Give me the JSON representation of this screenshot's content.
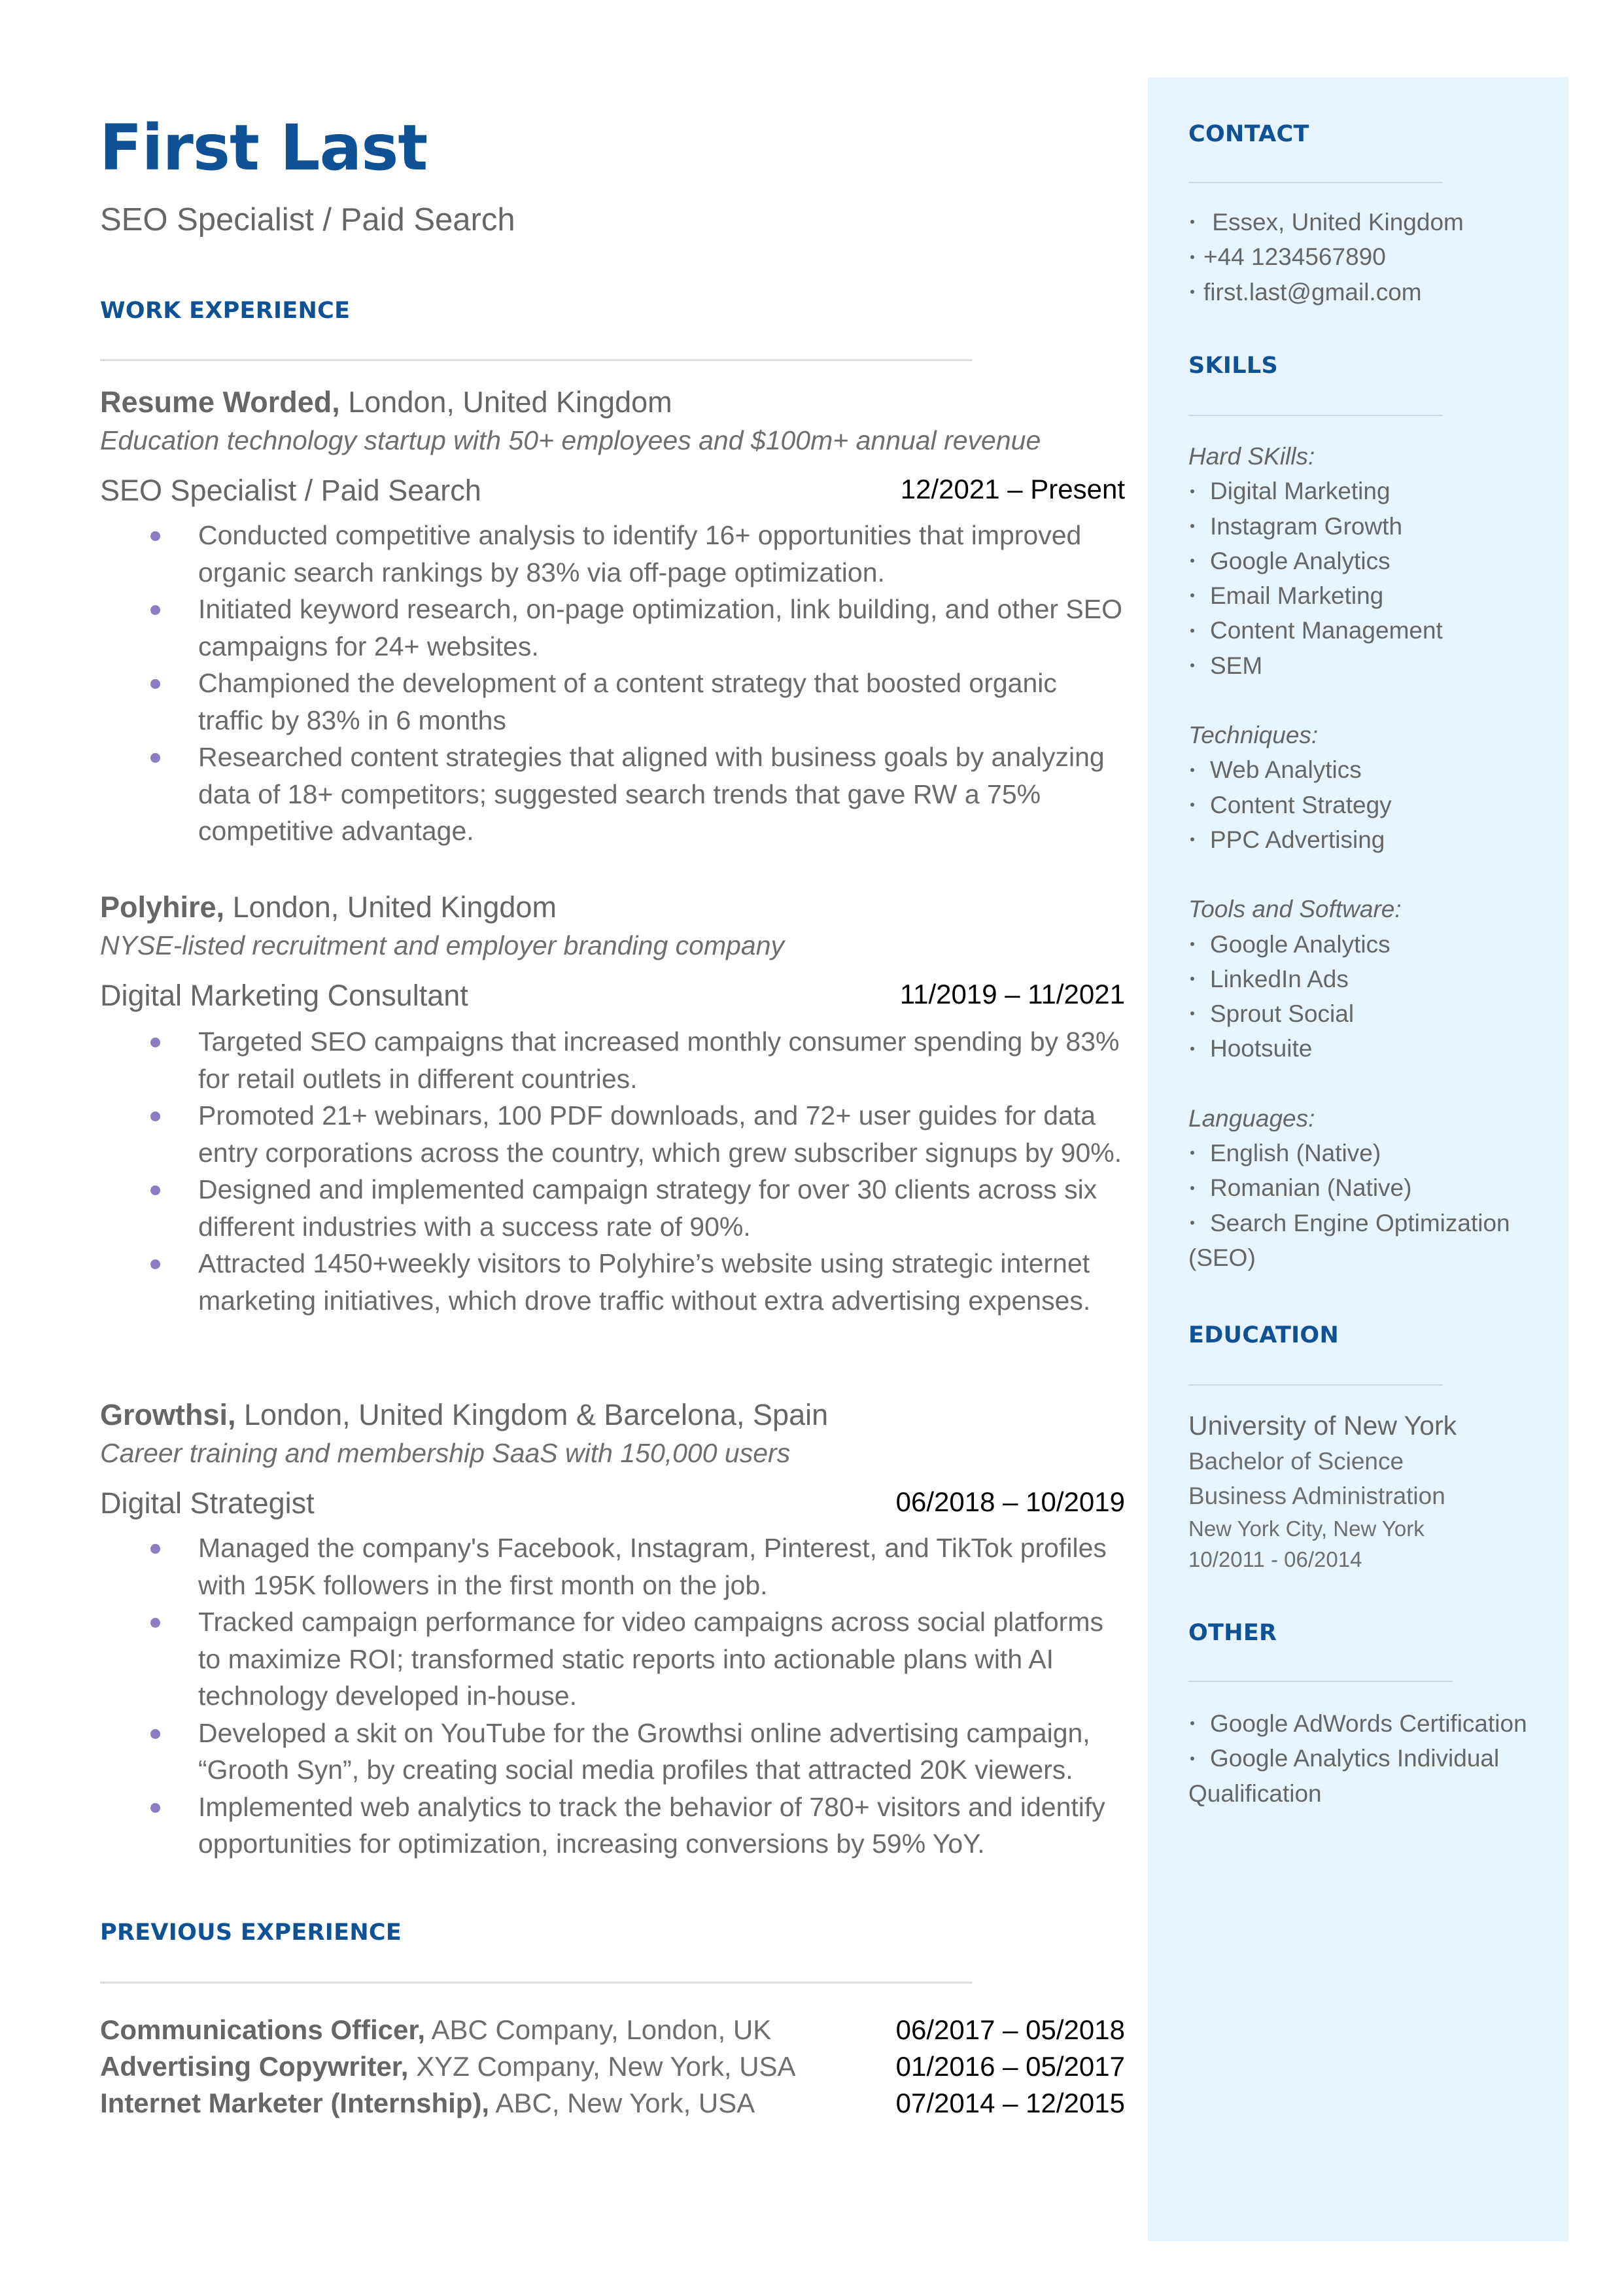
{
  "header": {
    "name": "First Last",
    "title": "SEO Specialist / Paid Search"
  },
  "sections": {
    "work_experience": "WORK EXPERIENCE",
    "previous_experience": "PREVIOUS EXPERIENCE",
    "contact": "CONTACT",
    "skills": "SKILLS",
    "education": "EDUCATION",
    "other": "OTHER"
  },
  "jobs": [
    {
      "company": "Resume Worded,",
      "location": " London, United Kingdom",
      "description": "Education technology startup with 50+ employees and $100m+ annual revenue",
      "role": "SEO Specialist / Paid Search",
      "dates": "12/2021 – Present",
      "bullets": [
        "Conducted competitive analysis to identify 16+ opportunities that improved organic search rankings by 83% via off-page optimization.",
        "Initiated keyword research, on-page optimization, link building, and other SEO campaigns for 24+ websites.",
        "Championed the development of a content strategy that boosted organic traffic by 83% in 6 months",
        "Researched content strategies that aligned with business goals by analyzing data of 18+ competitors; suggested search trends that gave RW a 75% competitive advantage."
      ]
    },
    {
      "company": "Polyhire,",
      "location": " London, United Kingdom",
      "description": "NYSE-listed recruitment and employer branding company",
      "role": "Digital Marketing Consultant",
      "dates": "11/2019 – 11/2021",
      "bullets": [
        "Targeted SEO campaigns that increased monthly consumer spending by 83% for retail outlets in different countries.",
        "Promoted 21+ webinars, 100 PDF downloads, and 72+ user guides for data entry corporations across the country, which grew subscriber signups by 90%.",
        "Designed and implemented campaign strategy for over 30 clients across six different industries with a success rate of 90%.",
        "Attracted 1450+weekly visitors to Polyhire’s website using strategic internet marketing initiatives, which drove traffic without extra advertising expenses."
      ]
    },
    {
      "company": "Growthsi,",
      "location": " London, United Kingdom & Barcelona, Spain",
      "description": "Career training and membership SaaS with 150,000 users",
      "role": "Digital Strategist",
      "dates": "06/2018 – 10/2019",
      "bullets": [
        "Managed the company's Facebook, Instagram, Pinterest, and TikTok profiles with 195K followers in the first month on the job.",
        "Tracked campaign performance for video campaigns across social platforms to maximize ROI; transformed static reports into actionable plans with AI technology developed in-house.",
        "Developed a skit on YouTube for the Growthsi online advertising campaign, “Grooth Syn”, by creating social media profiles that attracted 20K viewers.",
        "Implemented web analytics to track the behavior of 780+ visitors and identify opportunities for optimization, increasing conversions by 59% YoY."
      ]
    }
  ],
  "previous": [
    {
      "title": "Communications Officer,",
      "detail": " ABC Company, London, UK",
      "dates": "06/2017 – 05/2018"
    },
    {
      "title": "Advertising Copywriter,",
      "detail": " XYZ Company, New York, USA",
      "dates": "01/2016 – 05/2017"
    },
    {
      "title": "Internet Marketer (Internship),",
      "detail": " ABC, New York, USA",
      "dates": "07/2014 – 12/2015"
    }
  ],
  "contact": [
    " Essex, United Kingdom",
    "+44 1234567890",
    "first.last@gmail.com"
  ],
  "skills": {
    "hard_label": "Hard SKills:",
    "hard": [
      "Digital Marketing",
      "Instagram Growth",
      "Google Analytics",
      "Email Marketing",
      "Content Management",
      "SEM"
    ],
    "techniques_label": "Techniques:",
    "techniques": [
      "Web Analytics",
      "Content Strategy",
      "PPC Advertising"
    ],
    "tools_label": "Tools and Software:",
    "tools": [
      "Google Analytics",
      "LinkedIn Ads",
      "Sprout Social",
      "Hootsuite"
    ],
    "languages_label": "Languages:",
    "languages": [
      "English (Native)",
      "Romanian (Native)",
      "Search Engine Optimization (SEO)"
    ]
  },
  "education": {
    "school": "University of New York",
    "degree": "Bachelor of Science",
    "field": "Business Administration",
    "location": "New York City, New York",
    "dates": "10/2011 - 06/2014"
  },
  "other": [
    "Google AdWords Certification",
    "Google Analytics Individual Qualification"
  ],
  "colors": {
    "accent": "#0f5195",
    "bullet": "#8e7cc3",
    "sidebar_bg": "#e8f4fd",
    "text": "#666666"
  }
}
